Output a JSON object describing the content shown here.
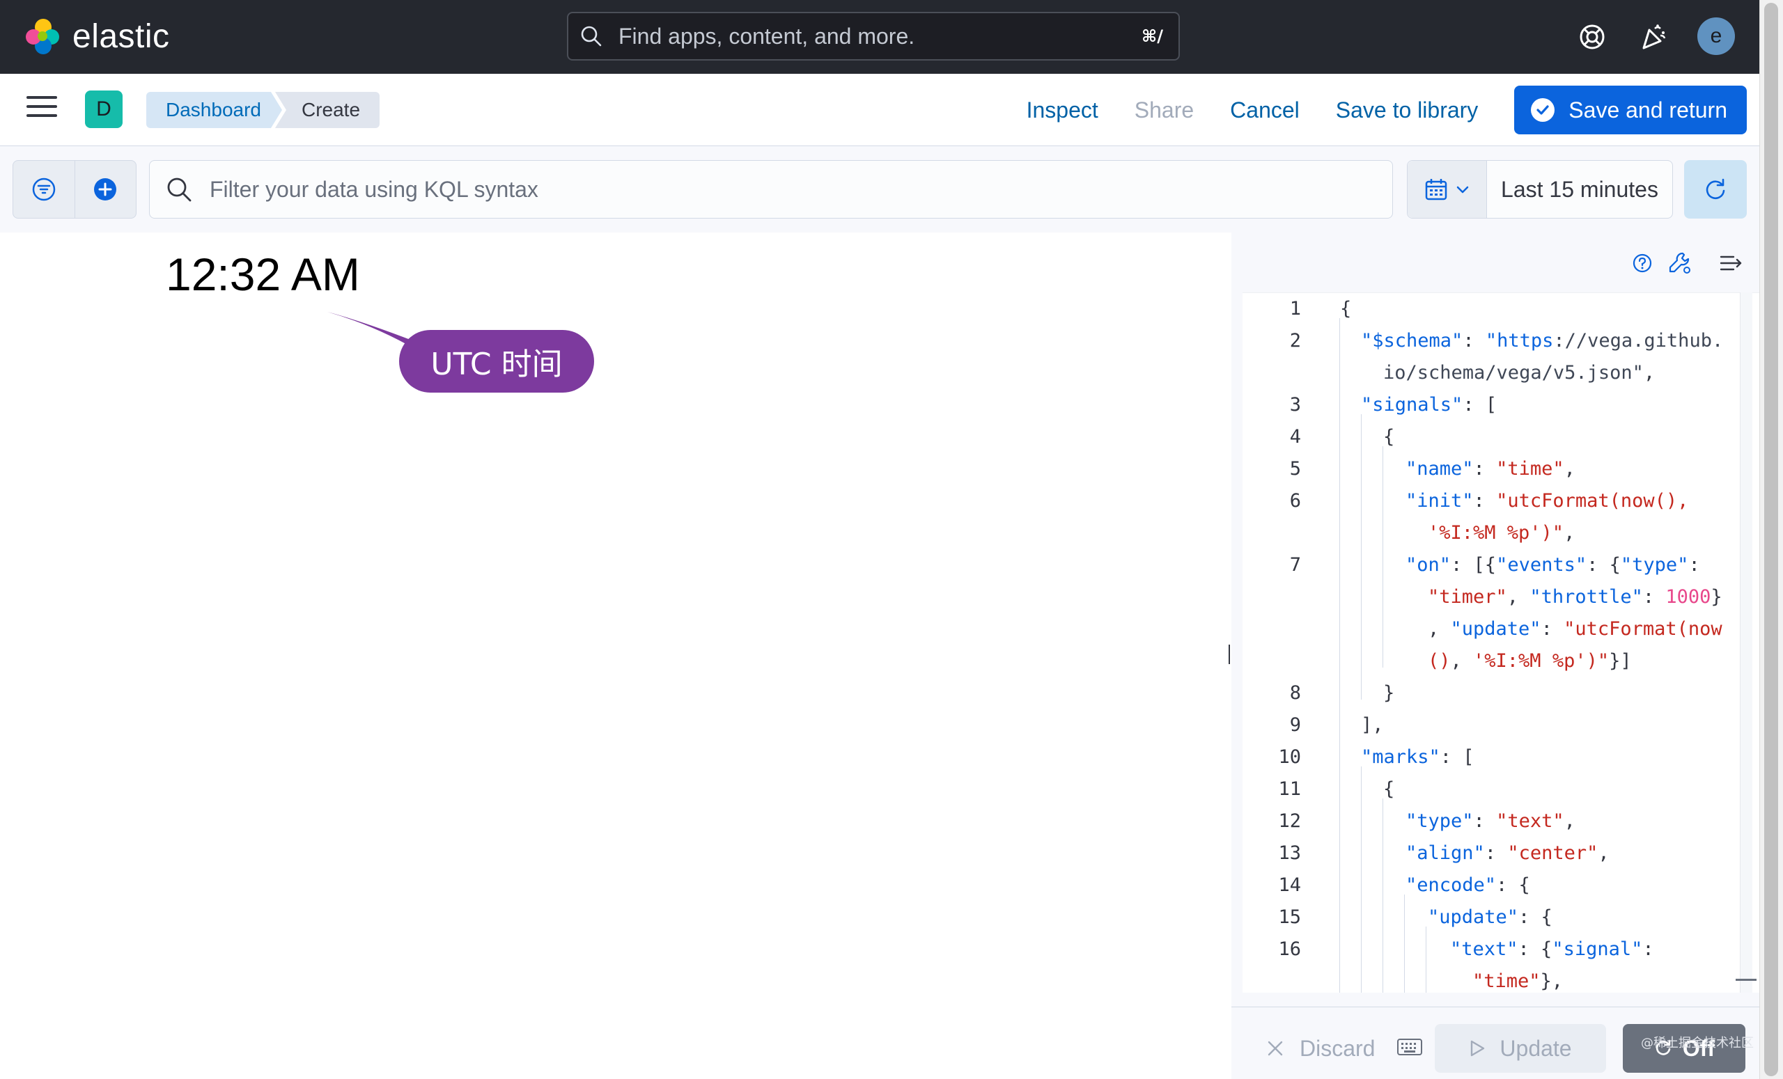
{
  "header": {
    "brand": "elastic",
    "search_placeholder": "Find apps, content, and more.",
    "search_shortcut": "⌘/",
    "help_icon": "lifebuoy-icon",
    "news_icon": "newsfeed-icon",
    "user_initial": "e"
  },
  "appbar": {
    "space_initial": "D",
    "breadcrumbs": [
      "Dashboard",
      "Create"
    ],
    "actions": {
      "inspect": "Inspect",
      "share": "Share",
      "cancel": "Cancel",
      "save_to_library": "Save to library",
      "save_and_return": "Save and return"
    }
  },
  "query": {
    "placeholder": "Filter your data using KQL syntax",
    "time_range": "Last 15 minutes"
  },
  "preview": {
    "clock_text": "12:32 AM",
    "annotation": "UTC 时间",
    "annotation_color": "#7d3a9e"
  },
  "editor": {
    "line_numbers": [
      "1",
      "2",
      "3",
      "4",
      "5",
      "6",
      "7",
      "8",
      "9",
      "10",
      "11",
      "12",
      "13",
      "14",
      "15",
      "16"
    ],
    "footer": {
      "discard": "Discard",
      "update": "Update",
      "auto_apply": "Off"
    }
  },
  "watermark": "@稀土掘金技术社区",
  "colors": {
    "header_bg": "#25282f",
    "primary": "#0b64dd",
    "link": "#0061a6",
    "code_key": "#0b64dd",
    "code_string": "#c4281f",
    "code_number": "#e8478b"
  }
}
